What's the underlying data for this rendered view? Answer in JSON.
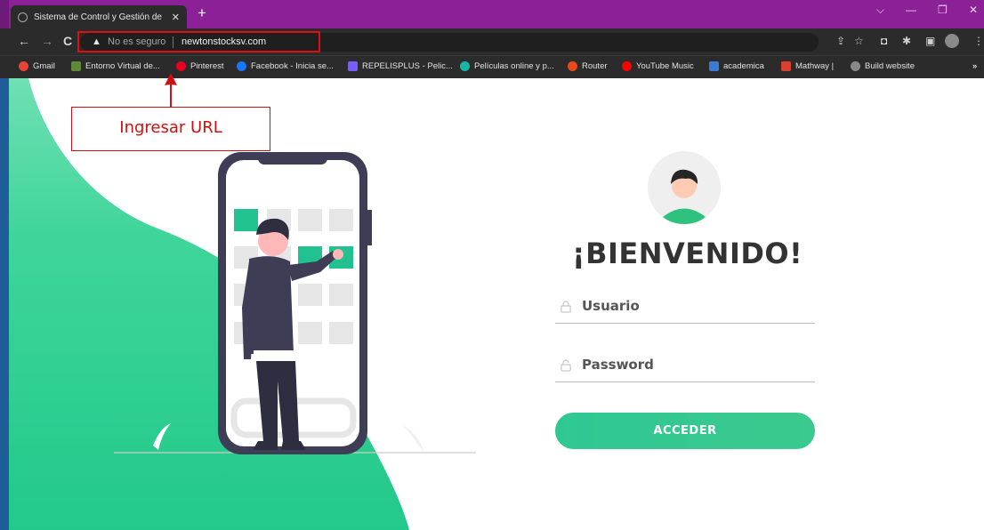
{
  "browser": {
    "tab_title": "Sistema de Control y Gestión de",
    "tab_close": "✕",
    "new_tab": "+",
    "window_controls": [
      "⌵",
      "—",
      "❐",
      "✕"
    ],
    "security_label": "No es seguro",
    "url": "newtonstocksv.com",
    "bookmarks": [
      {
        "label": "Gmail",
        "color": "#ea4335"
      },
      {
        "label": "Entorno Virtual de...",
        "color": "#5f8a3a"
      },
      {
        "label": "Pinterest",
        "color": "#e60023"
      },
      {
        "label": "Facebook - Inicia se...",
        "color": "#1877f2"
      },
      {
        "label": "REPELISPLUS - Pelic...",
        "color": "#7b5cff"
      },
      {
        "label": "Películas online y p...",
        "color": "#18b6a8"
      },
      {
        "label": "Router",
        "color": "#e84a1b"
      },
      {
        "label": "YouTube Music",
        "color": "#ff0000"
      },
      {
        "label": "academica",
        "color": "#3a7bd5"
      },
      {
        "label": "Mathway |",
        "color": "#d8412f"
      },
      {
        "label": "Build website",
        "color": "#888888"
      }
    ],
    "more_bookmarks": "»"
  },
  "page": {
    "welcome": "¡BIENVENIDO!",
    "username_placeholder": "Usuario",
    "password_placeholder": "Password",
    "login_button": "ACCEDER",
    "accent_color": "#2fc893"
  },
  "annotation": {
    "label": "Ingresar URL",
    "color": "#d01010"
  }
}
